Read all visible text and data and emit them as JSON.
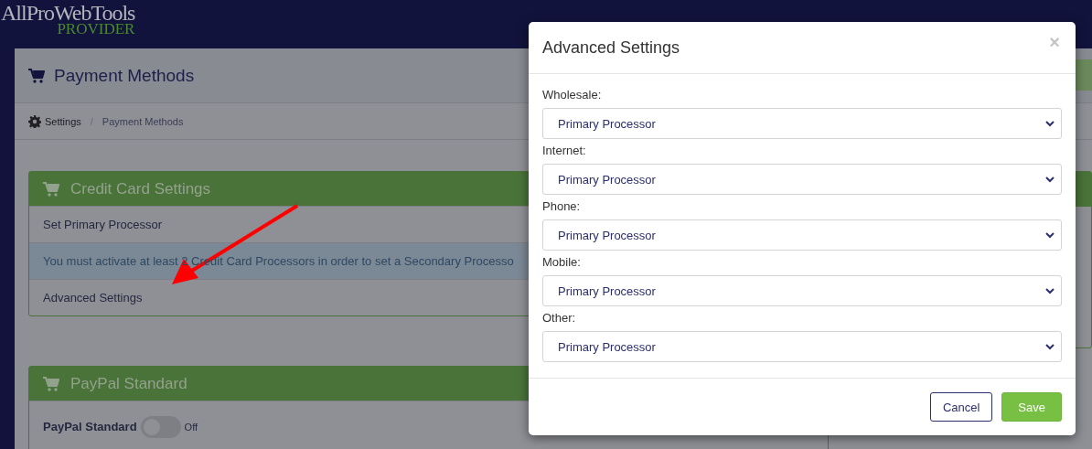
{
  "logo": {
    "name": "AllProWebTools",
    "tagline": "PROVIDER"
  },
  "page": {
    "title": "Payment Methods",
    "breadcrumb": [
      {
        "label": "Settings"
      },
      {
        "label": "Payment Methods"
      }
    ],
    "breadcrumb_separator": "/"
  },
  "panels": [
    {
      "title": "Credit Card Settings",
      "rows": [
        {
          "kind": "link",
          "text": "Set Primary Processor"
        },
        {
          "kind": "info",
          "text": "You must activate at least 2 Credit Card Processors in order to set a Secondary Processo"
        },
        {
          "kind": "link",
          "text": "Advanced Settings"
        }
      ]
    },
    {
      "title": "PayPal Standard",
      "rows": [
        {
          "kind": "toggle",
          "text": "PayPal Standard",
          "on": false,
          "state_label": "Off"
        }
      ]
    }
  ],
  "modal": {
    "title": "Advanced Settings",
    "close": "×",
    "fields": [
      {
        "label": "Wholesale:",
        "value": "Primary Processor"
      },
      {
        "label": "Internet:",
        "value": "Primary Processor"
      },
      {
        "label": "Phone:",
        "value": "Primary Processor"
      },
      {
        "label": "Mobile:",
        "value": "Primary Processor"
      },
      {
        "label": "Other:",
        "value": "Primary Processor"
      }
    ],
    "buttons": [
      {
        "label": "Cancel",
        "kind": "secondary"
      },
      {
        "label": "Save",
        "kind": "primary"
      }
    ]
  }
}
